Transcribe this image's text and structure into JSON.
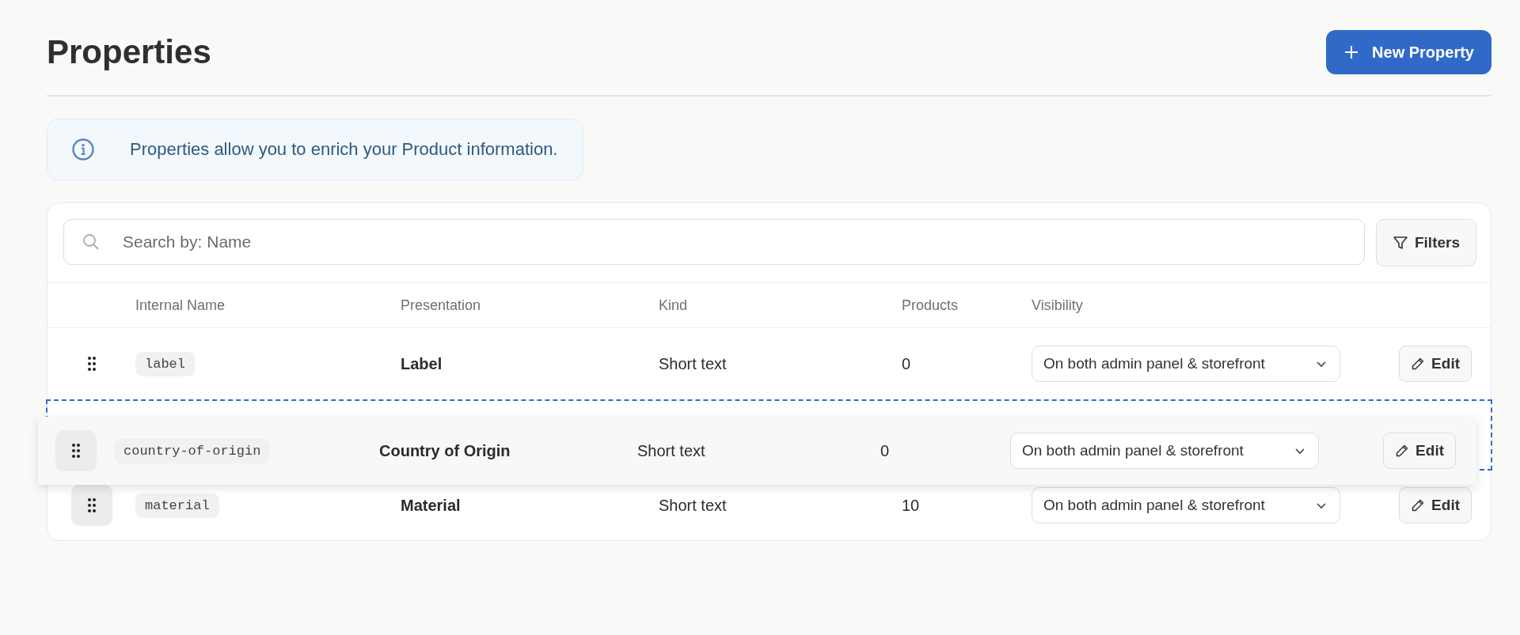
{
  "page": {
    "title": "Properties"
  },
  "new_button": {
    "label": "New Property"
  },
  "info": {
    "text": "Properties allow you to enrich your Product information."
  },
  "search": {
    "placeholder": "Search by: Name"
  },
  "filters_button": {
    "label": "Filters"
  },
  "table": {
    "columns": [
      "Internal Name",
      "Presentation",
      "Kind",
      "Products",
      "Visibility"
    ],
    "rows": [
      {
        "internal_name": "label",
        "presentation": "Label",
        "kind_text": "Short text",
        "products": "0",
        "visibility": "On both admin panel & storefront",
        "action": "Edit",
        "dragging": false,
        "hovered": false
      },
      {
        "internal_name": "country-of-origin",
        "presentation": "Country of Origin",
        "kind_text": "Short text",
        "products": "0",
        "visibility": "On both admin panel & storefront",
        "action": "Edit",
        "dragging": true,
        "hovered": true
      },
      {
        "internal_name": "material",
        "presentation": "Material",
        "kind_text": "Short text",
        "products": "10",
        "visibility": "On both admin panel & storefront",
        "action": "Edit",
        "dragging": false,
        "hovered": true
      }
    ]
  }
}
